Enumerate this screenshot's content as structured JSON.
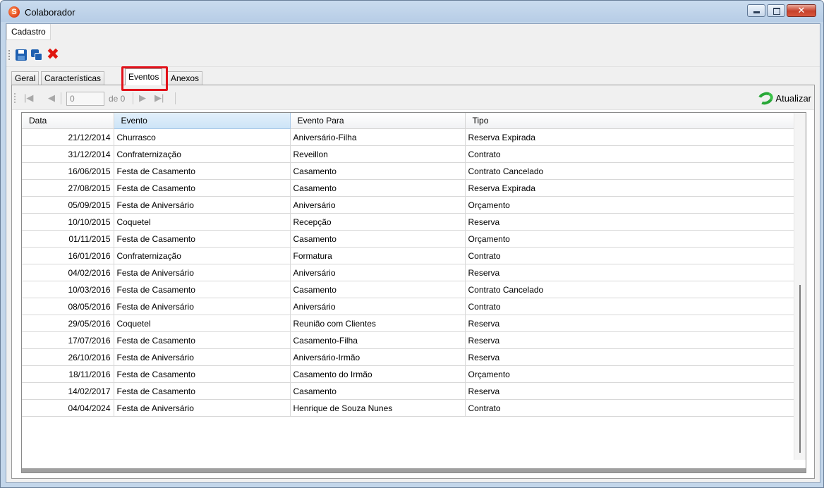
{
  "window": {
    "title": "Colaborador",
    "app_icon_letter": "S"
  },
  "menu": {
    "items": [
      "Cadastro"
    ]
  },
  "toolbar": {
    "icons": [
      "save-icon",
      "save-all-icon",
      "delete-icon"
    ]
  },
  "tabs": [
    {
      "label": "Geral",
      "active": false
    },
    {
      "label": "Características",
      "active": false
    },
    {
      "label": "Eventos",
      "active": true
    },
    {
      "label": "Anexos",
      "active": false
    }
  ],
  "navigator": {
    "position_value": "0",
    "count_label": "de 0",
    "refresh_label": "Atualizar"
  },
  "grid": {
    "columns": [
      "Data",
      "Evento",
      "Evento Para",
      "Tipo"
    ],
    "rows": [
      [
        "21/12/2014",
        "Churrasco",
        "Aniversário-Filha",
        "Reserva Expirada"
      ],
      [
        "31/12/2014",
        "Confraternização",
        "Reveillon",
        "Contrato"
      ],
      [
        "16/06/2015",
        "Festa de Casamento",
        "Casamento",
        "Contrato Cancelado"
      ],
      [
        "27/08/2015",
        "Festa de Casamento",
        "Casamento",
        "Reserva Expirada"
      ],
      [
        "05/09/2015",
        "Festa de Aniversário",
        "Aniversário",
        "Orçamento"
      ],
      [
        "10/10/2015",
        "Coquetel",
        "Recepção",
        "Reserva"
      ],
      [
        "01/11/2015",
        "Festa de Casamento",
        "Casamento",
        "Orçamento"
      ],
      [
        "16/01/2016",
        "Confraternização",
        "Formatura",
        "Contrato"
      ],
      [
        "04/02/2016",
        "Festa de Aniversário",
        "Aniversário",
        "Reserva"
      ],
      [
        "10/03/2016",
        "Festa de Casamento",
        "Casamento",
        "Contrato Cancelado"
      ],
      [
        "08/05/2016",
        "Festa de Aniversário",
        "Aniversário",
        "Contrato"
      ],
      [
        "29/05/2016",
        "Coquetel",
        "Reunião com Clientes",
        "Reserva"
      ],
      [
        "17/07/2016",
        "Festa de Casamento",
        "Casamento-Filha",
        "Reserva"
      ],
      [
        "26/10/2016",
        "Festa de Aniversário",
        "Aniversário-Irmão",
        "Reserva"
      ],
      [
        "18/11/2016",
        "Festa de Casamento",
        "Casamento do Irmão",
        "Orçamento"
      ],
      [
        "14/02/2017",
        "Festa de Casamento",
        "Casamento",
        "Reserva"
      ],
      [
        "04/04/2024",
        "Festa de Aniversário",
        "Henrique de Souza Nunes",
        "Contrato"
      ]
    ]
  },
  "colors": {
    "highlight": "#e2121a",
    "sorted_header": "#cde4f7",
    "refresh_green": "#27a736"
  }
}
